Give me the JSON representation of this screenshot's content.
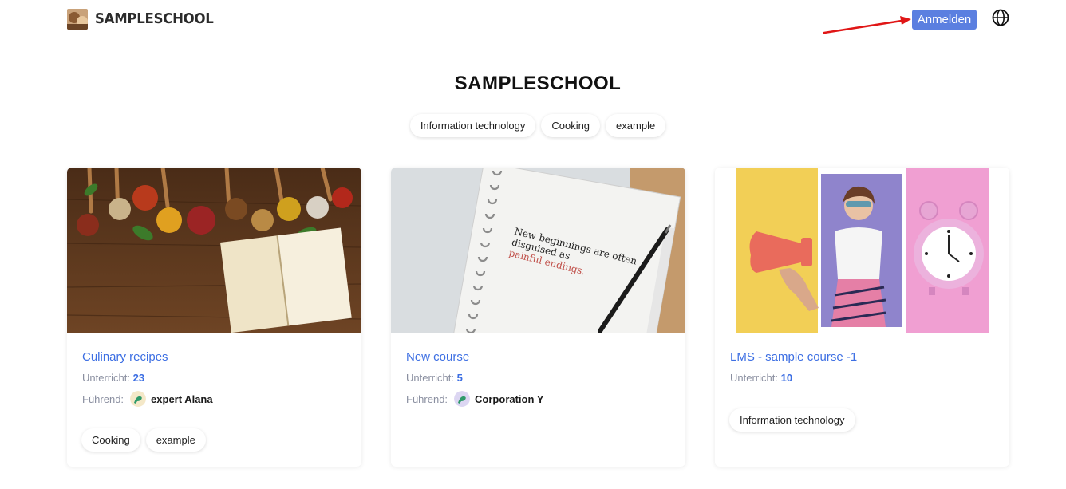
{
  "header": {
    "brand": "SAMPLESCHOOL",
    "login_label": "Anmelden"
  },
  "hero": {
    "title": "SAMPLESCHOOL",
    "filters": [
      "Information technology",
      "Cooking",
      "example"
    ]
  },
  "labels": {
    "lessons": "Unterricht:",
    "leader": "Führend:"
  },
  "courses": [
    {
      "title": "Culinary recipes",
      "lessons": "23",
      "leader": "expert Alana",
      "tags": [
        "Cooking",
        "example"
      ]
    },
    {
      "title": "New course",
      "lessons": "5",
      "leader": "Corporation Y",
      "notebook_text": [
        "New beginnings are often",
        "disguised as",
        "painful endings."
      ]
    },
    {
      "title": "LMS - sample course -1",
      "lessons": "10",
      "tags": [
        "Information technology"
      ]
    }
  ],
  "colors": {
    "accent": "#3d6fe3",
    "login_button": "#5b7fe0",
    "annotation_arrow": "#e01616"
  },
  "icons": {
    "globe": "globe-icon",
    "arrow": "red-annotation-arrow"
  }
}
